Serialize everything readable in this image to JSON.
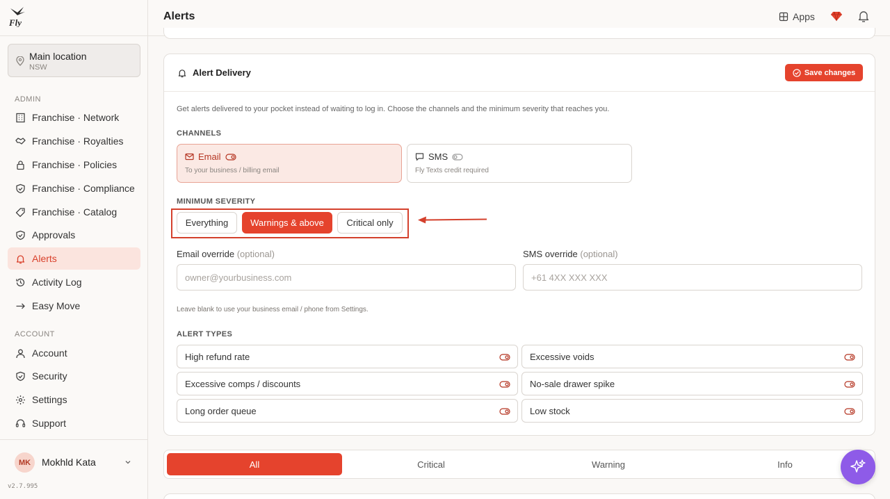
{
  "app": {
    "logo_text": "Fly",
    "version": "v2.7.995"
  },
  "location": {
    "name": "Main location",
    "region": "NSW"
  },
  "sidebar": {
    "admin_label": "ADMIN",
    "admin_items": [
      {
        "label": "Franchise · Network",
        "icon": "building-icon"
      },
      {
        "label": "Franchise · Royalties",
        "icon": "handshake-icon"
      },
      {
        "label": "Franchise · Policies",
        "icon": "lock-icon"
      },
      {
        "label": "Franchise · Compliance",
        "icon": "shield-check-icon"
      },
      {
        "label": "Franchise · Catalog",
        "icon": "tag-icon"
      },
      {
        "label": "Approvals",
        "icon": "shield-check-icon"
      },
      {
        "label": "Alerts",
        "icon": "bell-icon",
        "active": true
      },
      {
        "label": "Activity Log",
        "icon": "history-icon"
      },
      {
        "label": "Easy Move",
        "icon": "arrow-right-icon"
      }
    ],
    "account_label": "ACCOUNT",
    "account_items": [
      {
        "label": "Account",
        "icon": "user-icon"
      },
      {
        "label": "Security",
        "icon": "shield-icon"
      },
      {
        "label": "Settings",
        "icon": "gear-icon"
      },
      {
        "label": "Support",
        "icon": "headset-icon"
      }
    ]
  },
  "user": {
    "initials": "MK",
    "name": "Mokhld Kata"
  },
  "header": {
    "title": "Alerts",
    "apps_label": "Apps"
  },
  "delivery": {
    "title": "Alert Delivery",
    "save_label": "Save changes",
    "description": "Get alerts delivered to your pocket instead of waiting to log in. Choose the channels and the minimum severity that reaches you.",
    "channels_label": "CHANNELS",
    "channels": [
      {
        "title": "Email",
        "subtitle": "To your business / billing email",
        "selected": true
      },
      {
        "title": "SMS",
        "subtitle": "Fly Texts credit required",
        "selected": false
      }
    ],
    "severity_label": "MINIMUM SEVERITY",
    "severity_options": [
      "Everything",
      "Warnings & above",
      "Critical only"
    ],
    "severity_selected": "Warnings & above",
    "email_override_label": "Email override",
    "sms_override_label": "SMS override",
    "optional_text": "(optional)",
    "email_placeholder": "owner@yourbusiness.com",
    "sms_placeholder": "+61 4XX XXX XXX",
    "override_hint": "Leave blank to use your business email / phone from Settings.",
    "alert_types_label": "ALERT TYPES",
    "alert_types": [
      "High refund rate",
      "Excessive voids",
      "Excessive comps / discounts",
      "No-sale drawer spike",
      "Long order queue",
      "Low stock"
    ]
  },
  "filter_tabs": {
    "items": [
      "All",
      "Critical",
      "Warning",
      "Info"
    ],
    "selected": "All"
  },
  "colors": {
    "accent": "#e5432d",
    "accent_soft": "#fbe4de",
    "fab": "#8e5be8"
  }
}
